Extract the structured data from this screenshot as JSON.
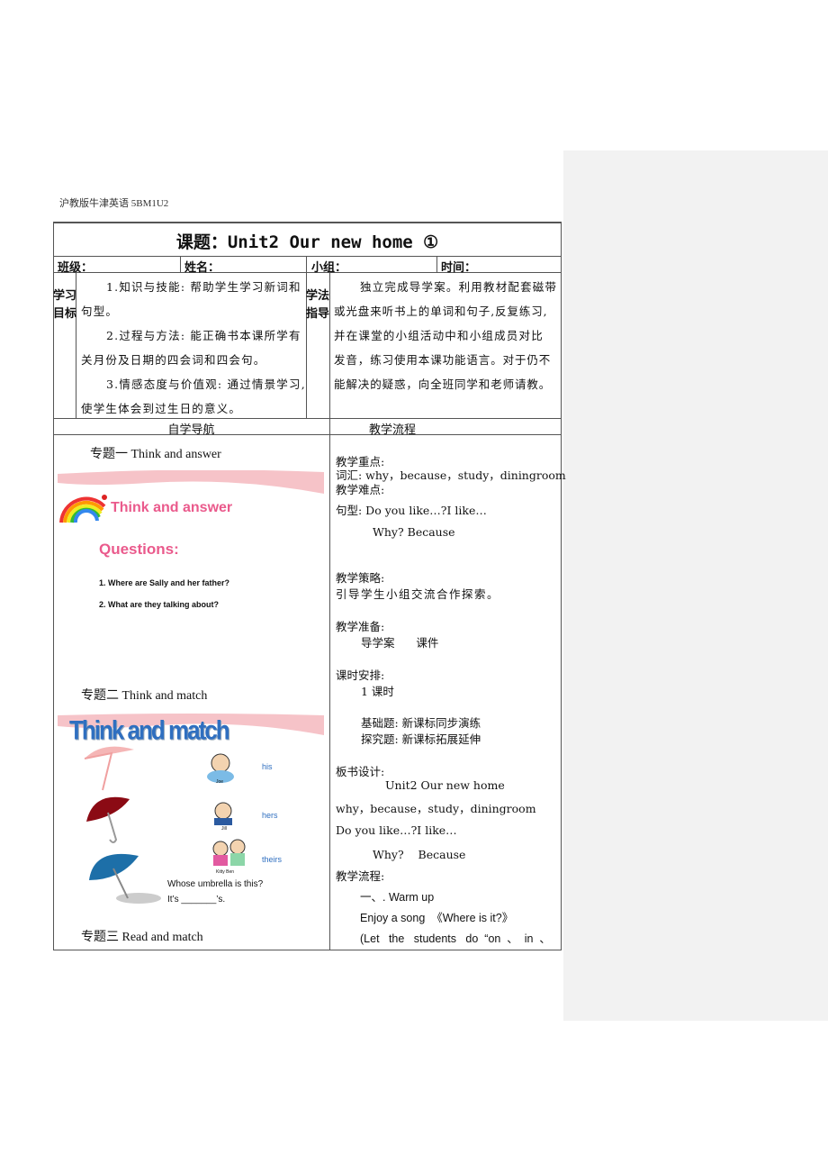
{
  "header": "沪教版牛津英语 5BM1U2",
  "title": "课题：Unit2 Our new home ①",
  "info": {
    "class": "班级：",
    "name": "姓名：",
    "group": "小组：",
    "time": "时间："
  },
  "objectives": {
    "label": "学习目标",
    "lines": [
      "1.知识与技能: 帮助学生学习新词和",
      "句型。",
      "2.过程与方法: 能正确书本课所学有",
      "关月份及日期的四会词和四会句。",
      "3.情感态度与价值观: 通过情景学习,",
      "使学生体会到过生日的意义。"
    ]
  },
  "method": {
    "label": "学法指导",
    "lines": [
      "独立完成导学案。利用教材配套磁带",
      "或光盘来听书上的单词和句子,反复练习,",
      "并在课堂的小组活动中和小组成员对比",
      "发音，练习使用本课功能语言。对于仍不",
      "能解决的疑惑，向全班同学和老师请教。"
    ]
  },
  "col_headers": {
    "left": "自学导航",
    "right": "教学流程"
  },
  "left": {
    "topic1": "专题一  Think and answer",
    "slide1": {
      "title": "Think and answer",
      "questions_label": "Questions:",
      "questions": [
        "1. Where are Sally and her father?",
        "2. What are they talking about?"
      ]
    },
    "topic2": "专题二    Think and match",
    "slide2": {
      "title": "Think and match",
      "names": [
        "Joe",
        "Jill",
        "Kitty  Ben"
      ],
      "words": [
        "his",
        "hers",
        "theirs"
      ],
      "q1": "Whose umbrella is this?",
      "q2": "It’s _______’s."
    },
    "topic3": "专题三  Read and match"
  },
  "right": {
    "lines": [
      "教学重点:",
      "词汇: why，because，study，diningroom",
      "教学难点:",
      "句型:  Do you like…?I like…",
      "Why?    Because",
      "教学策略:",
      "引导学生小组交流合作探索。",
      "教学准备:",
      "导学案      课件",
      "课时安排:",
      "1 课时",
      "基础题: 新课标同步演练",
      "探究题: 新课标拓展延伸",
      "板书设计:",
      "Unit2 Our new home",
      "why，because，study，diningroom",
      "Do you like…?I like…",
      "Why?    Because",
      "教学流程:",
      "一、. Warm up",
      "Enjoy a song  《Where is it?》",
      "(Let   the   students   do  “on  、  in  、"
    ]
  },
  "colors": {
    "pink": "#ea5a8c",
    "blue": "#2f6fc0",
    "sidebar": "#f2f2f2"
  }
}
